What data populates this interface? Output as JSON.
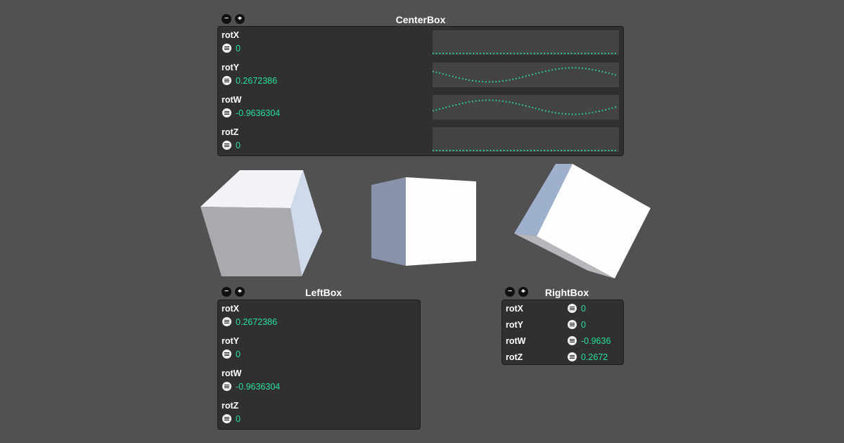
{
  "center_box": {
    "title": "CenterBox",
    "rows": [
      {
        "label": "rotX",
        "value": "0"
      },
      {
        "label": "rotY",
        "value": "0.2672386"
      },
      {
        "label": "rotW",
        "value": "-0.9636304"
      },
      {
        "label": "rotZ",
        "value": "0"
      }
    ],
    "graph_color": "#27e09a"
  },
  "left_box": {
    "title": "LeftBox",
    "rows": [
      {
        "label": "rotX",
        "value": "0.2672386"
      },
      {
        "label": "rotY",
        "value": "0"
      },
      {
        "label": "rotW",
        "value": "-0.9636304"
      },
      {
        "label": "rotZ",
        "value": "0"
      }
    ]
  },
  "right_box": {
    "title": "RightBox",
    "rows": [
      {
        "label": "rotX",
        "value": "0"
      },
      {
        "label": "rotY",
        "value": "0"
      },
      {
        "label": "rotW",
        "value": "-0.9636"
      },
      {
        "label": "rotZ",
        "value": "0.2672"
      }
    ]
  },
  "icons": {
    "minimize": "minus-icon",
    "fit": "expand-icon",
    "value_menu": "menu-icon"
  },
  "colors": {
    "background": "#515151",
    "panel": "#303030",
    "value_text": "#27e09a"
  }
}
